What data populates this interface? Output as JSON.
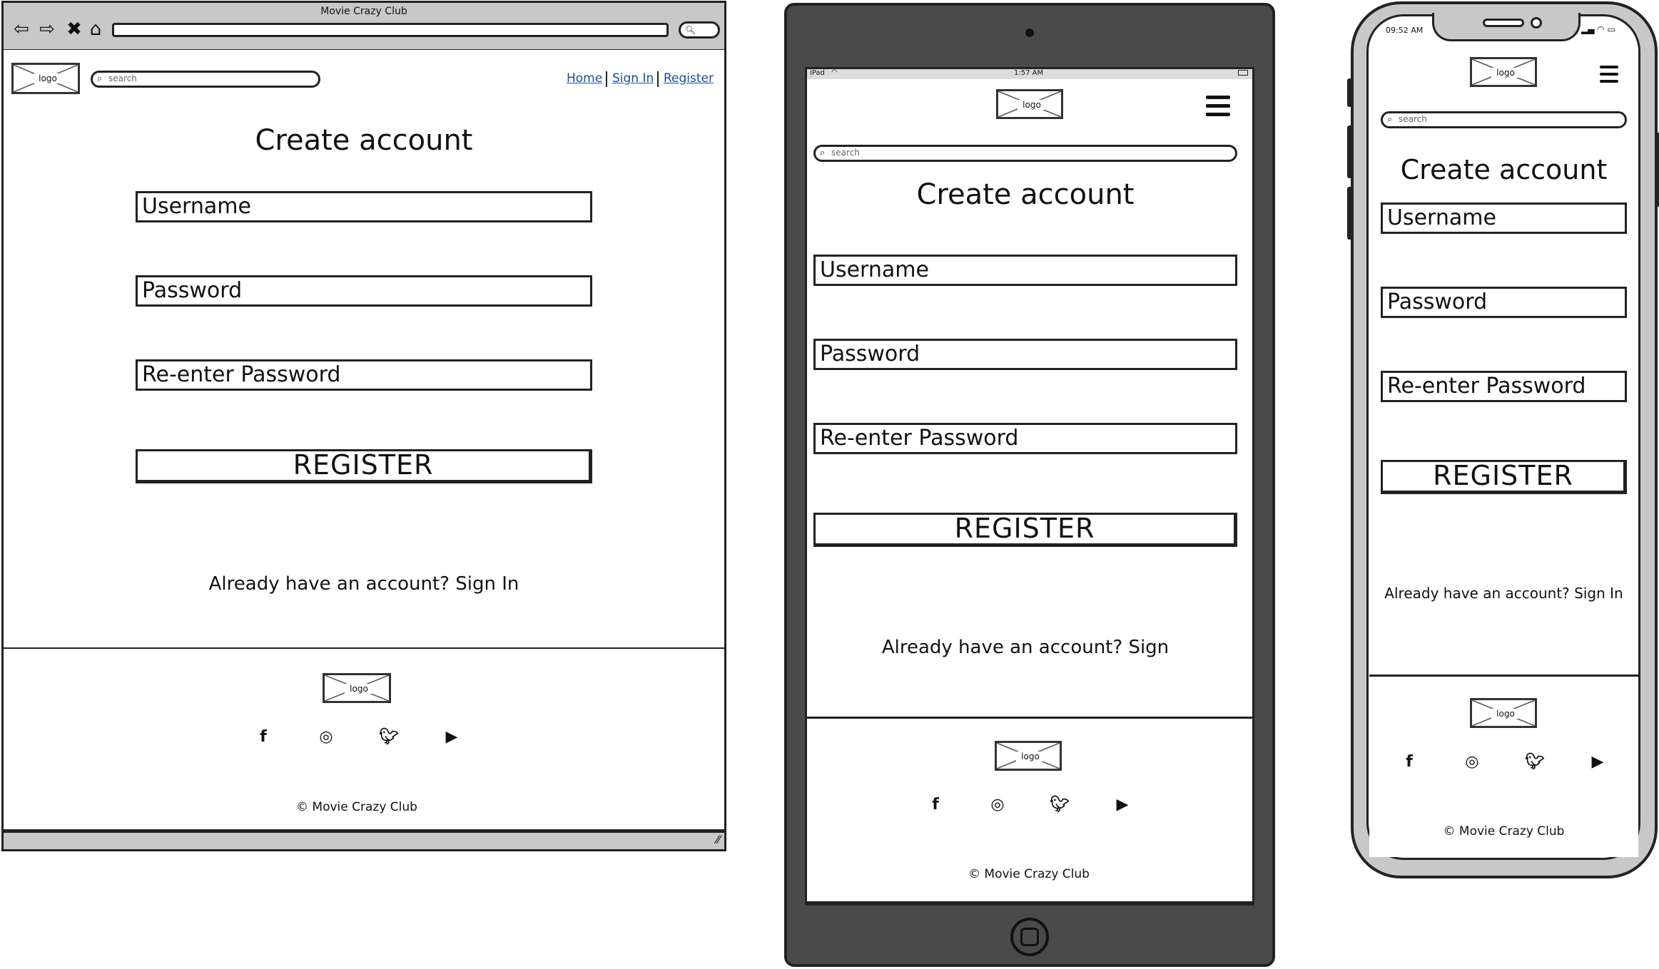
{
  "desktop": {
    "window_title": "Movie Crazy Club",
    "logo_text": "logo",
    "search_placeholder": "search",
    "nav": {
      "home": "Home",
      "sign_in": "Sign In",
      "register": "Register"
    },
    "heading": "Create account",
    "fields": {
      "username": "Username",
      "password": "Password",
      "reenter": "Re-enter Password"
    },
    "button": "REGISTER",
    "signin_prompt": "Already have an account? Sign In",
    "footer_logo": "logo",
    "copyright": "© Movie Crazy Club"
  },
  "tablet": {
    "status_left": "iPad",
    "status_time": "1:57 AM",
    "logo_text": "logo",
    "search_placeholder": "search",
    "heading": "Create account",
    "fields": {
      "username": "Username",
      "password": "Password",
      "reenter": "Re-enter Password"
    },
    "button": "REGISTER",
    "signin_prompt": "Already have an account? Sign",
    "footer_logo": "logo",
    "copyright": "© Movie Crazy Club"
  },
  "phone": {
    "status_time": "09:52 AM",
    "logo_text": "logo",
    "search_placeholder": "search",
    "heading": "Create account",
    "fields": {
      "username": "Username",
      "password": "Password",
      "reenter": "Re-enter Password"
    },
    "button": "REGISTER",
    "signin_prompt": "Already have an account? Sign In",
    "footer_logo": "logo",
    "copyright": "© Movie Crazy Club"
  },
  "icons": {
    "social": [
      "facebook-icon",
      "instagram-icon",
      "twitter-icon",
      "youtube-icon"
    ]
  },
  "colors": {
    "frame_gray": "#c8c8c8",
    "tablet_body": "#4a4a4a",
    "link_blue": "#1a4d9c"
  }
}
